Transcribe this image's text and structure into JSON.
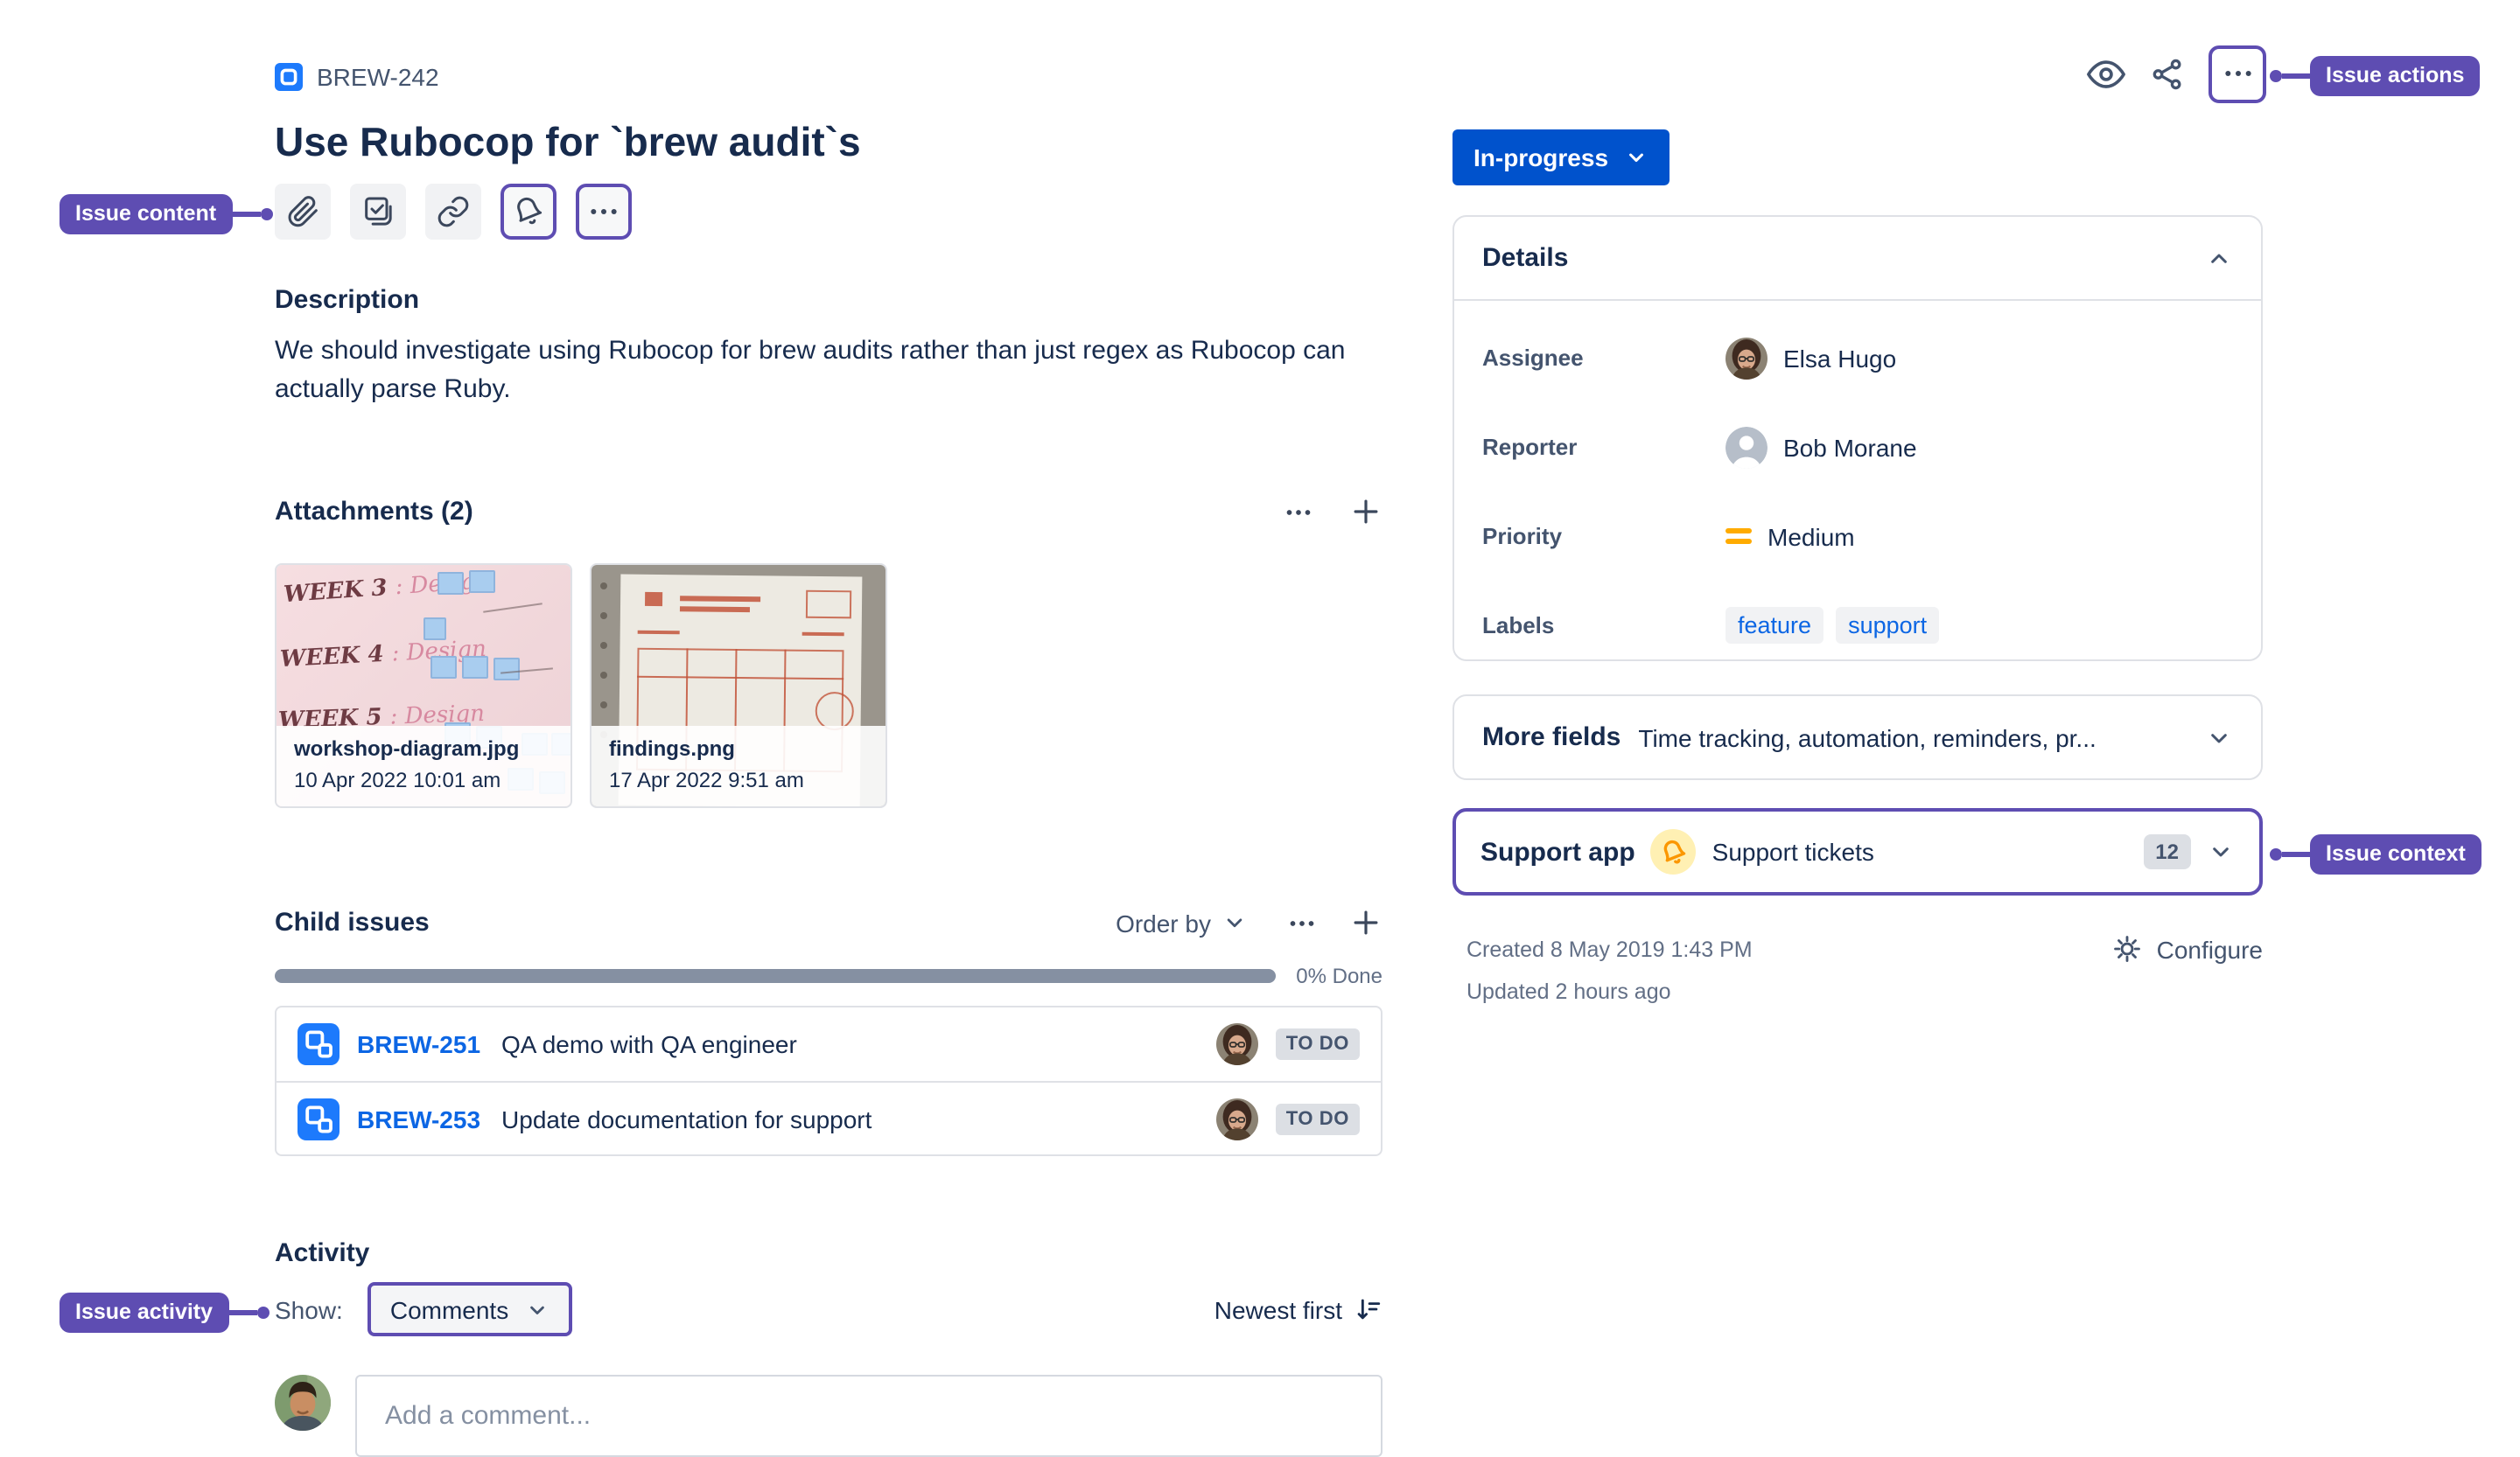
{
  "colors": {
    "annotation_purple": "#5E4DB2",
    "status_blue": "#0052CC",
    "link_blue": "#0C66E4",
    "priority_orange": "#FFAB00"
  },
  "annotations": {
    "actions": "Issue actions",
    "content": "Issue content",
    "context": "Issue context",
    "activity": "Issue activity"
  },
  "issue": {
    "key": "BREW-242",
    "title": "Use Rubocop for `brew audit`s"
  },
  "description": {
    "heading": "Description",
    "body": "We should investigate using Rubocop for brew audits rather than just regex as Rubocop can actually parse Ruby."
  },
  "attachments": {
    "heading": "Attachments (2)",
    "items": [
      {
        "filename": "workshop-diagram.jpg",
        "date": "10 Apr 2022 10:01 am"
      },
      {
        "filename": "findings.png",
        "date": "17 Apr 2022 9:51 am"
      }
    ]
  },
  "child_issues": {
    "heading": "Child issues",
    "order_by_label": "Order by",
    "progress_label": "0% Done",
    "items": [
      {
        "key": "BREW-251",
        "summary": "QA demo with QA engineer",
        "status": "TO DO"
      },
      {
        "key": "BREW-253",
        "summary": "Update documentation for support",
        "status": "TO DO"
      }
    ]
  },
  "activity": {
    "heading": "Activity",
    "show_label": "Show:",
    "filter_value": "Comments",
    "sort_label": "Newest first",
    "comment_placeholder": "Add a comment..."
  },
  "status": {
    "label": "In-progress"
  },
  "details": {
    "heading": "Details",
    "assignee_label": "Assignee",
    "assignee_value": "Elsa Hugo",
    "reporter_label": "Reporter",
    "reporter_value": "Bob Morane",
    "priority_label": "Priority",
    "priority_value": "Medium",
    "labels_label": "Labels",
    "labels": [
      "feature",
      "support"
    ]
  },
  "more_fields": {
    "title": "More fields",
    "summary": "Time tracking, automation, reminders, pr..."
  },
  "support_app": {
    "title": "Support app",
    "subtitle": "Support tickets",
    "count": "12"
  },
  "footer": {
    "created": "Created 8 May 2019 1:43 PM",
    "updated": "Updated 2 hours ago",
    "configure_label": "Configure"
  }
}
